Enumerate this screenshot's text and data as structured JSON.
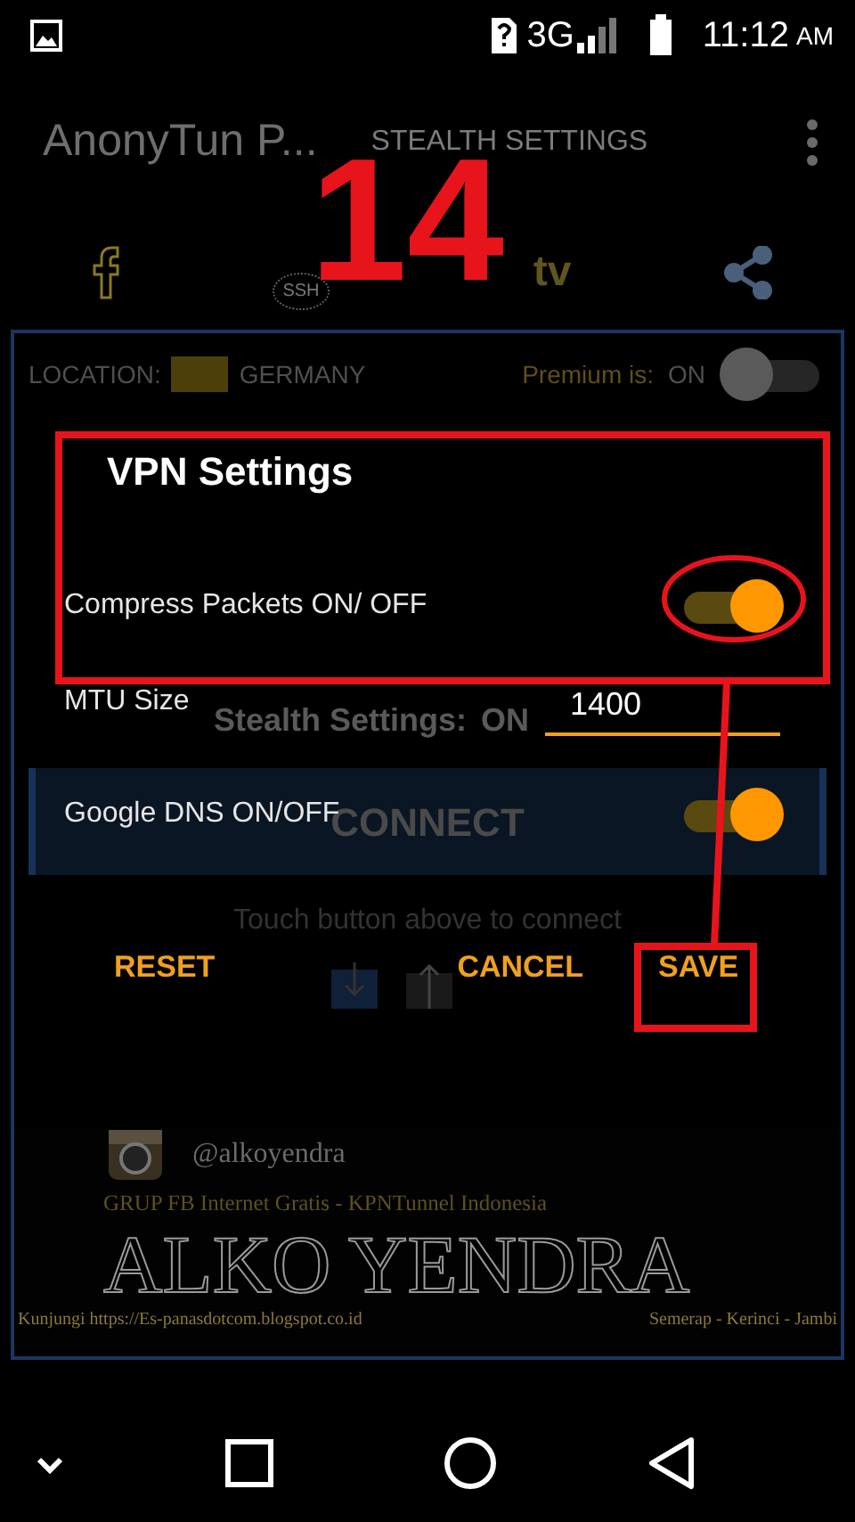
{
  "status_bar": {
    "network": "3G",
    "time": "11:12",
    "ampm": "AM"
  },
  "app_bar": {
    "title": "AnonyTun P...",
    "action": "STEALTH SETTINGS"
  },
  "shortcuts": [
    {
      "kind": "facebook"
    },
    {
      "kind": "ssh",
      "label": "SSH"
    },
    {
      "kind": "tv",
      "label": "tv"
    },
    {
      "kind": "share"
    }
  ],
  "main": {
    "location_label": "LOCATION:",
    "location": "GERMANY",
    "premium_label": "Premium is:",
    "premium_value": "ON",
    "premium_switch_on": false,
    "stealth_label": "Stealth Settings:",
    "stealth_value": "ON",
    "connect_button": "CONNECT",
    "hint": "Touch button above to connect"
  },
  "banner": {
    "handle": "@alkoyendra",
    "group": "GRUP FB Internet Gratis - KPNTunnel Indonesia",
    "name": "ALKO YENDRA",
    "visit": "Kunjungi https://Es-panasdotcom.blogspot.co.id",
    "place": "Semerap  - Kerinci - Jambi"
  },
  "dialog": {
    "title": "VPN Settings",
    "settings": [
      {
        "kind": "switch",
        "label": "Compress Packets ON/ OFF",
        "on": true
      },
      {
        "kind": "input",
        "label": "MTU Size",
        "value": "1400"
      },
      {
        "kind": "switch",
        "label": "Google DNS ON/OFF",
        "on": true
      }
    ],
    "buttons": [
      "RESET",
      "CANCEL",
      "SAVE"
    ]
  },
  "annotation": {
    "number": "14"
  }
}
